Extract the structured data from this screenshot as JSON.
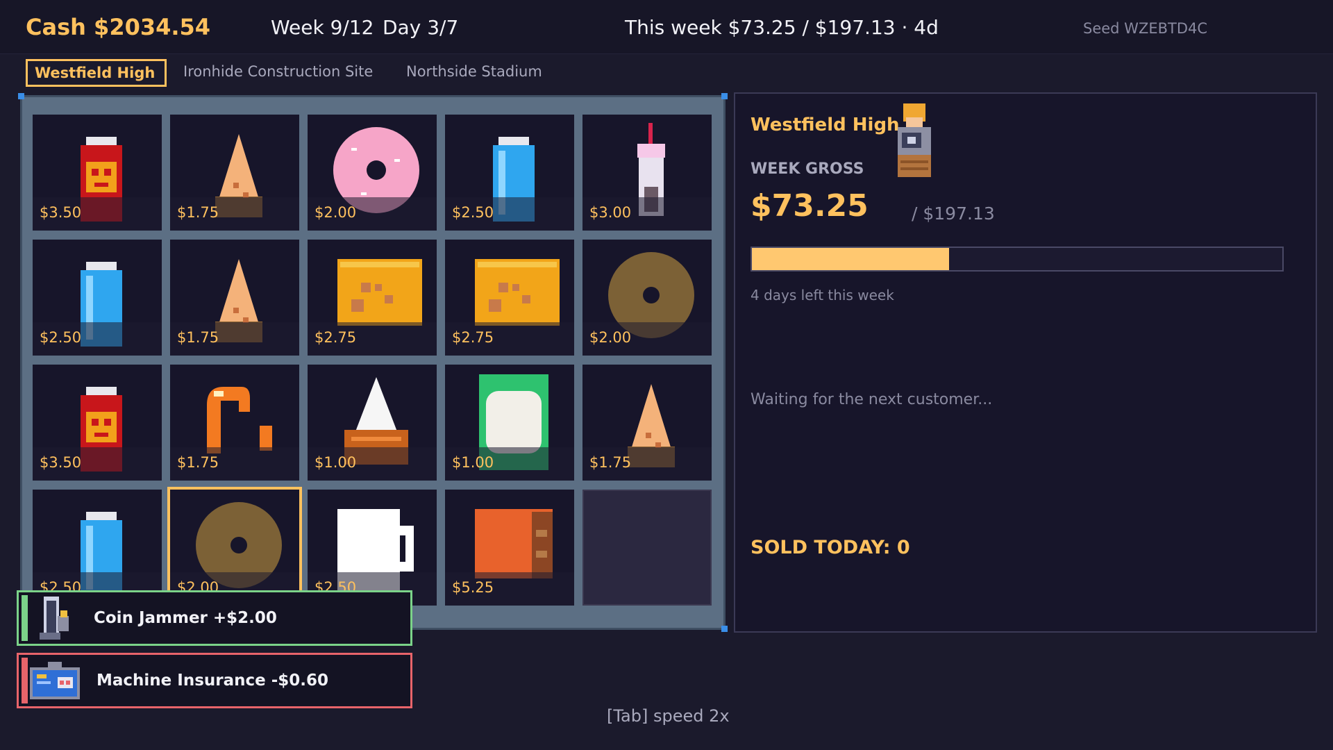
{
  "header": {
    "cash": "Cash $2034.54",
    "week": "Week 9/12",
    "day": "Day 3/7",
    "week_progress": "This week $73.25 / $197.13 · 4d",
    "seed": "Seed WZEBTD4C"
  },
  "tabs": [
    {
      "label": "Westfield High",
      "active": true
    },
    {
      "label": "Ironhide Construction Site",
      "active": false
    },
    {
      "label": "Northside Stadium",
      "active": false
    }
  ],
  "slots": [
    {
      "item": "red-soda-can-icon",
      "price": "$3.50"
    },
    {
      "item": "chips-bag-icon",
      "price": "$1.75"
    },
    {
      "item": "pink-donut-icon",
      "price": "$2.00"
    },
    {
      "item": "blue-water-can-icon",
      "price": "$2.50"
    },
    {
      "item": "bubble-tea-icon",
      "price": "$3.00"
    },
    {
      "item": "blue-water-can-icon",
      "price": "$2.50"
    },
    {
      "item": "chips-bag-icon",
      "price": "$1.75"
    },
    {
      "item": "cheese-cracker-icon",
      "price": "$2.75"
    },
    {
      "item": "cheese-cracker-icon",
      "price": "$2.75"
    },
    {
      "item": "chocolate-donut-icon",
      "price": "$2.00"
    },
    {
      "item": "red-soda-can-icon",
      "price": "$3.50"
    },
    {
      "item": "shrimp-icon",
      "price": "$1.75"
    },
    {
      "item": "onigiri-icon",
      "price": "$1.00"
    },
    {
      "item": "mint-candy-icon",
      "price": "$1.00"
    },
    {
      "item": "chips-bag-icon",
      "price": "$1.75"
    },
    {
      "item": "blue-water-can-icon",
      "price": "$2.50"
    },
    {
      "item": "chocolate-donut-icon",
      "price": "$2.00"
    },
    {
      "item": "milk-carton-icon",
      "price": "$2.50"
    },
    {
      "item": "sandwich-icon",
      "price": "$5.25"
    },
    {
      "item": "empty-slot",
      "price": ""
    }
  ],
  "side_panel": {
    "location_name": "Westfield High",
    "week_gross_label": "WEEK GROSS",
    "week_gross_value": "$73.25",
    "week_target": "/ $197.13",
    "progress_fraction": 0.3716,
    "days_left": "4 days left this week",
    "waiting": "Waiting for the next customer...",
    "sold_today": "SOLD TODAY: 0"
  },
  "notices": [
    {
      "label": "Coin Jammer  +$2.00",
      "icon": "coin-jammer-icon",
      "color": "#7bd389"
    },
    {
      "label": "Machine Insurance  -$0.60",
      "icon": "machine-insurance-icon",
      "color": "#e8646a"
    }
  ],
  "footer": {
    "hint": "[Tab] speed 2x"
  },
  "colors": {
    "accent": "#ffc15e",
    "background": "#1b1a2c",
    "machine_frame": "#5c6f84"
  }
}
